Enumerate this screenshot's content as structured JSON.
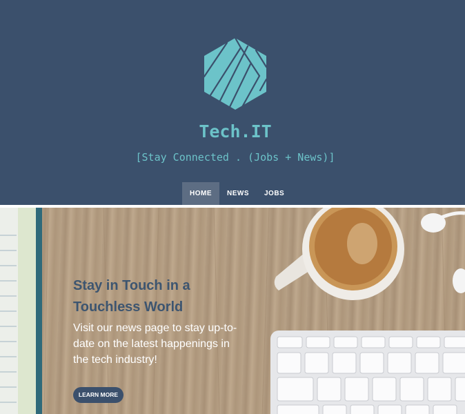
{
  "brand": {
    "title": "Tech.IT",
    "tagline": "[Stay Connected . (Jobs + News)]",
    "logo_icon": "hexagon-logo-icon"
  },
  "nav": {
    "items": [
      {
        "label": "HOME",
        "active": true
      },
      {
        "label": "NEWS",
        "active": false
      },
      {
        "label": "JOBS",
        "active": false
      }
    ]
  },
  "hero": {
    "heading": "Stay in Touch in a Touchless World",
    "text": "Visit our news page to stay up-to-date on the latest happenings in the tech industry!",
    "button_label": "LEARN MORE"
  },
  "colors": {
    "header_bg": "#3b506c",
    "accent": "#6cc3c9",
    "nav_active_bg": "#5d6d83",
    "heading": "#3d5570"
  }
}
